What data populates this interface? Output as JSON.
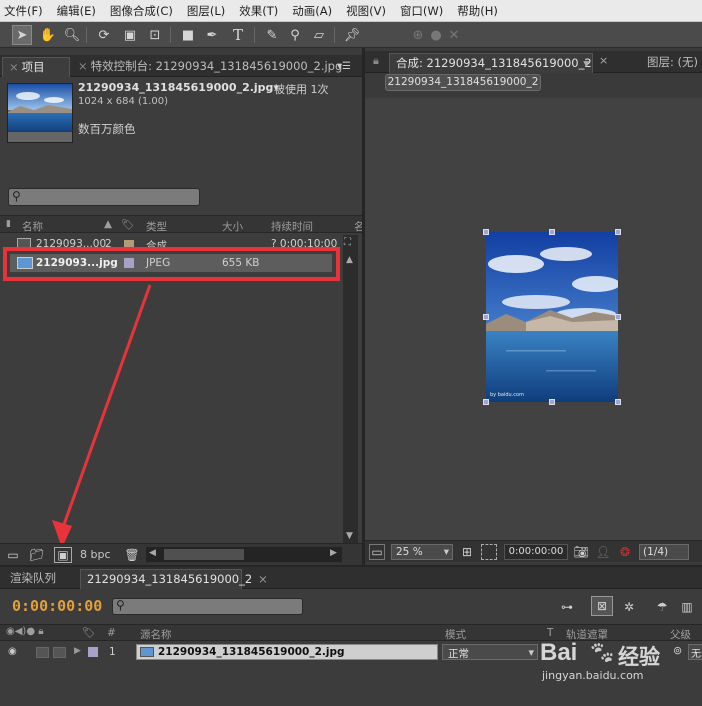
{
  "menu": [
    "文件(F)",
    "编辑(E)",
    "图像合成(C)",
    "图层(L)",
    "效果(T)",
    "动画(A)",
    "视图(V)",
    "窗口(W)",
    "帮助(H)"
  ],
  "project_panel": {
    "tab_project": "项目",
    "tab_effects": "特效控制台: 21290934_131845619000_2.jpg",
    "file_name": "21290934_131845619000_2.jpg▾",
    "used_count": "被使用 1次",
    "dimensions": "1024 x 684 (1.00)",
    "color_depth_label": "数百万颜色",
    "columns": {
      "name": "名称",
      "type": "类型",
      "size": "大小",
      "duration": "持续时间",
      "extra": "名"
    },
    "rows": [
      {
        "name": "2129093...00",
        "num": "2",
        "type": "合成",
        "size": "",
        "duration": "? 0:00:10:00",
        "color": "#b39a78"
      },
      {
        "name": "2129093...jpg",
        "num": "",
        "type": "JPEG",
        "size": "655 KB",
        "duration": "",
        "color": "#a7a3c8"
      }
    ],
    "bpc": "8 bpc"
  },
  "comp_panel": {
    "tab_comp": "合成: 21290934_131845619000_2",
    "tab_layer": "图层: (无)",
    "comp_button": "21290934_131845619000_2",
    "zoom": "25 %",
    "timecode": "0:00:00:00",
    "resolution": "(1/4)",
    "watermark": "by baidu.com"
  },
  "timeline": {
    "tab_render": "渲染队列",
    "tab_comp": "21290934_131845619000_2",
    "timecode": "0:00:00:00",
    "col_source": "源名称",
    "col_mode": "模式",
    "col_t": "T",
    "col_track": "轨道遮罩",
    "col_parent": "父级",
    "layer_num": "1",
    "layer_name": "21290934_131845619000_2.jpg",
    "layer_mode": "正常",
    "parent_value": "无"
  },
  "watermark": {
    "site": "jingyan.baidu.com",
    "brand": "Bai",
    "brand2": "经验"
  },
  "colors": {
    "accent_timecode": "#e3a03a",
    "highlight": "#e8333a"
  }
}
